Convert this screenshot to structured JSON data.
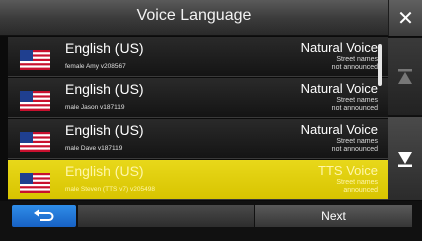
{
  "header": {
    "title": "Voice Language",
    "close_icon": "close-icon"
  },
  "rows": [
    {
      "language": "English (US)",
      "detail": "female Amy v208567",
      "voice_type": "Natural Voice",
      "note_line1": "Street names",
      "note_line2": "not announced",
      "flag_icon": "us-flag-icon",
      "selected": false
    },
    {
      "language": "English (US)",
      "detail": "male Jason v187119",
      "voice_type": "Natural Voice",
      "note_line1": "Street names",
      "note_line2": "not announced",
      "flag_icon": "us-flag-icon",
      "selected": false
    },
    {
      "language": "English (US)",
      "detail": "male Dave v187119",
      "voice_type": "Natural Voice",
      "note_line1": "Street names",
      "note_line2": "not announced",
      "flag_icon": "us-flag-icon",
      "selected": false
    },
    {
      "language": "English (US)",
      "detail": "male Steven (TTS v7) v205498",
      "voice_type": "TTS Voice",
      "note_line1": "Street names",
      "note_line2": "announced",
      "flag_icon": "us-flag-icon",
      "selected": true
    }
  ],
  "scroll": {
    "up_icon": "scroll-up-icon",
    "down_icon": "scroll-down-icon"
  },
  "footer": {
    "back_icon": "back-arrow-icon",
    "next_label": "Next"
  },
  "colors": {
    "selected_row": "#e0cc0a",
    "back_button": "#1f74d6",
    "header": "#444444"
  }
}
